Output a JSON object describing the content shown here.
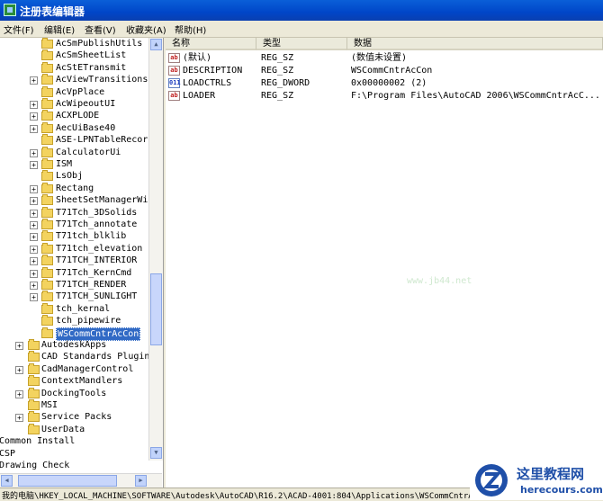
{
  "window": {
    "title": "注册表编辑器"
  },
  "menu": [
    {
      "label": "文件(F)"
    },
    {
      "label": "编辑(E)"
    },
    {
      "label": "查看(V)"
    },
    {
      "label": "收藏夹(A)"
    },
    {
      "label": "帮助(H)"
    }
  ],
  "tree": {
    "items": [
      {
        "label": "AcSmPublishUtils",
        "expandable": false
      },
      {
        "label": "AcSmSheetList",
        "expandable": false
      },
      {
        "label": "AcStETransmit",
        "expandable": false
      },
      {
        "label": "AcViewTransitionsUi",
        "expandable": true
      },
      {
        "label": "AcVpPlace",
        "expandable": false
      },
      {
        "label": "AcWipeoutUI",
        "expandable": true
      },
      {
        "label": "ACXPLODE",
        "expandable": true
      },
      {
        "label": "AecUiBase40",
        "expandable": true
      },
      {
        "label": "ASE-LPNTableRecord",
        "expandable": false
      },
      {
        "label": "CalculatorUi",
        "expandable": true
      },
      {
        "label": "ISM",
        "expandable": true
      },
      {
        "label": "LsObj",
        "expandable": false
      },
      {
        "label": "Rectang",
        "expandable": true
      },
      {
        "label": "SheetSetManagerWizar",
        "expandable": true
      },
      {
        "label": "T71Tch_3DSolids",
        "expandable": true
      },
      {
        "label": "T71Tch_annotate",
        "expandable": true
      },
      {
        "label": "T71tch_blklib",
        "expandable": true
      },
      {
        "label": "T71tch_elevation",
        "expandable": true
      },
      {
        "label": "T71TCH_INTERIOR",
        "expandable": true
      },
      {
        "label": "T71Tch_KernCmd",
        "expandable": true
      },
      {
        "label": "T71TCH_RENDER",
        "expandable": true
      },
      {
        "label": "T71TCH_SUNLIGHT",
        "expandable": true
      },
      {
        "label": "tch_kernal",
        "expandable": false
      },
      {
        "label": "tch_pipewire",
        "expandable": false
      },
      {
        "label": "WSCommCntrAcCon",
        "expandable": false,
        "selected": true
      },
      {
        "label": "AutodeskApps",
        "expandable": true,
        "level": 1
      },
      {
        "label": "CAD Standards Plugins",
        "expandable": false,
        "level": 1
      },
      {
        "label": "CadManagerControl",
        "expandable": true,
        "level": 1
      },
      {
        "label": "ContextMandlers",
        "expandable": false,
        "level": 1
      },
      {
        "label": "DockingTools",
        "expandable": true,
        "level": 1
      },
      {
        "label": "MSI",
        "expandable": false,
        "level": 1
      },
      {
        "label": "Service Packs",
        "expandable": true,
        "level": 1
      },
      {
        "label": "UserData",
        "expandable": false,
        "level": 1
      },
      {
        "label": "Common Install",
        "level": 0
      },
      {
        "label": "CSP",
        "level": 0
      },
      {
        "label": "Drawing Check",
        "level": 0
      }
    ]
  },
  "list": {
    "columns": [
      "名称",
      "类型",
      "数据"
    ],
    "rows": [
      {
        "icon": "ab",
        "name": "(默认)",
        "type": "REG_SZ",
        "data": "(数值未设置)"
      },
      {
        "icon": "ab",
        "name": "DESCRIPTION",
        "type": "REG_SZ",
        "data": "WSCommCntrAcCon"
      },
      {
        "icon": "bin",
        "name": "LOADCTRLS",
        "type": "REG_DWORD",
        "data": "0x00000002 (2)"
      },
      {
        "icon": "ab",
        "name": "LOADER",
        "type": "REG_SZ",
        "data": "F:\\Program Files\\AutoCAD 2006\\WSCommCntrAcC..."
      }
    ]
  },
  "watermark": "www.jb44.net",
  "status": {
    "path": "我的电脑\\HKEY_LOCAL_MACHINE\\SOFTWARE\\Autodesk\\AutoCAD\\R16.2\\ACAD-4001:804\\Applications\\WSCommCntrAcCon"
  },
  "logo": {
    "cn": "这里教程网",
    "en": "herecours.com"
  },
  "colors": {
    "selection": "#316ac5",
    "titlebar": "#0054e3"
  }
}
